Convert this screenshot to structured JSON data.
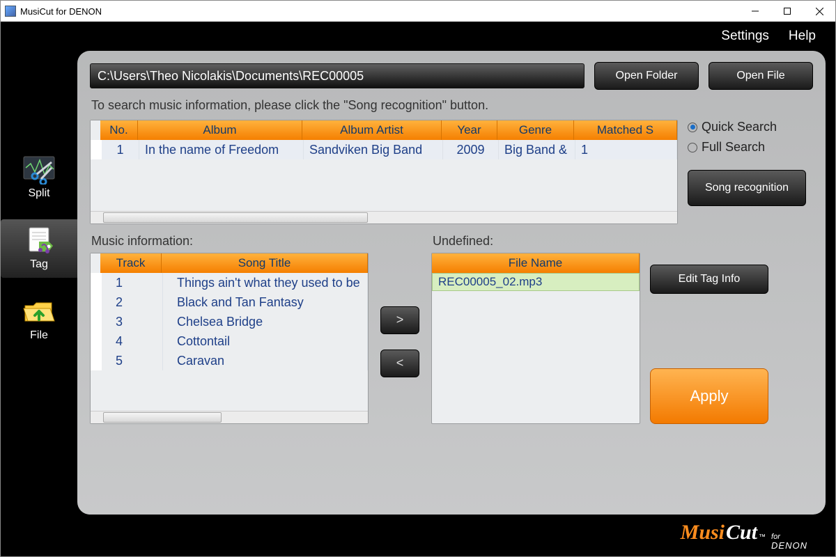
{
  "chrome": {
    "title": "MusiCut for DENON"
  },
  "menu": {
    "settings": "Settings",
    "help": "Help"
  },
  "nav": {
    "split": "Split",
    "tag": "Tag",
    "file": "File"
  },
  "path": "C:\\Users\\Theo Nicolakis\\Documents\\REC00005",
  "buttons": {
    "open_folder": "Open Folder",
    "open_file": "Open File",
    "song_recognition": "Song recognition",
    "edit_tag": "Edit Tag Info",
    "apply": "Apply",
    "move_right": ">",
    "move_left": "<"
  },
  "instruction": "To search music information, please click the \"Song recognition\" button.",
  "search": {
    "quick": "Quick Search",
    "full": "Full Search",
    "selected": "quick"
  },
  "album_table": {
    "headers": {
      "no": "No.",
      "album": "Album",
      "artist": "Album Artist",
      "year": "Year",
      "genre": "Genre",
      "matched": "Matched S"
    },
    "rows": [
      {
        "no": "1",
        "album": "In the name of Freedom",
        "artist": "Sandviken Big Band",
        "year": "2009",
        "genre": "Big Band &",
        "matched": "1"
      }
    ]
  },
  "music_info": {
    "label": "Music information:",
    "headers": {
      "track": "Track",
      "title": "Song Title"
    },
    "rows": [
      {
        "track": "1",
        "title": "Things ain't what they used to be"
      },
      {
        "track": "2",
        "title": "Black and Tan Fantasy"
      },
      {
        "track": "3",
        "title": "Chelsea Bridge"
      },
      {
        "track": "4",
        "title": "Cottontail"
      },
      {
        "track": "5",
        "title": "Caravan"
      }
    ]
  },
  "undefined_files": {
    "label": "Undefined:",
    "header": "File Name",
    "rows": [
      "REC00005_02.mp3"
    ]
  },
  "logo": {
    "part1": "Musi",
    "part2": "Cut",
    "tm": "™",
    "sub1": "for",
    "sub2": "DENON"
  }
}
